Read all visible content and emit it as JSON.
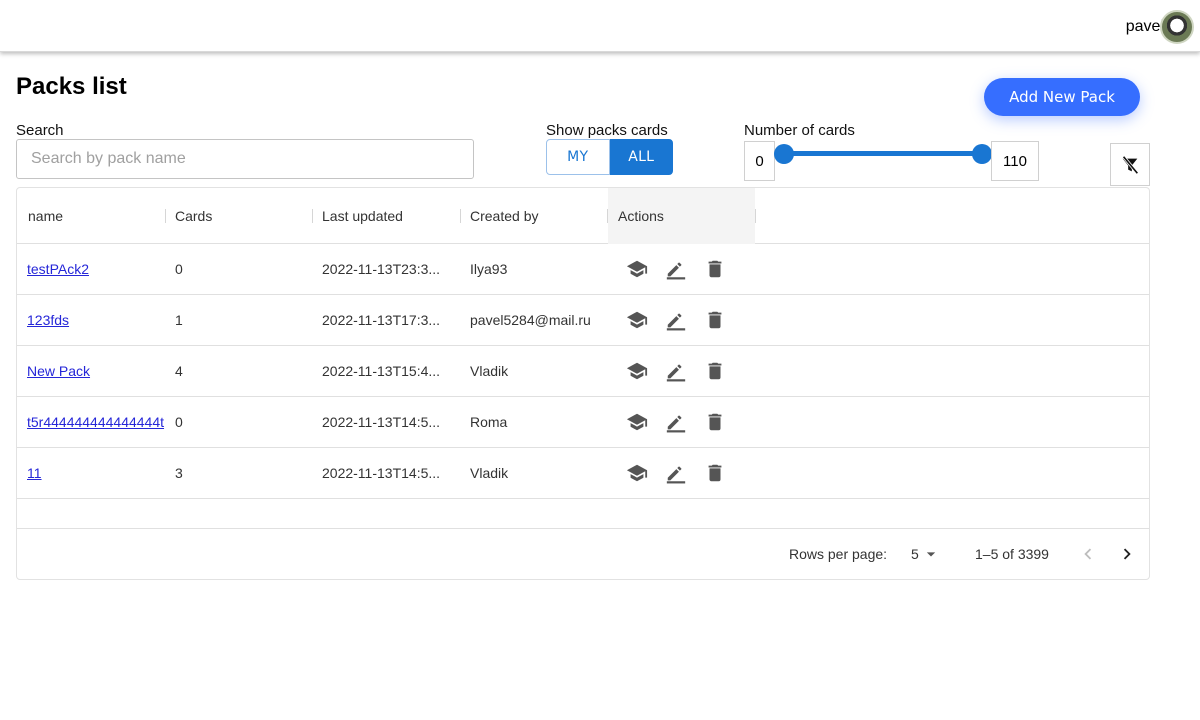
{
  "header": {
    "user_name": "pavel",
    "avatar_icon": "user-avatar"
  },
  "page": {
    "title": "Packs list",
    "add_button": "Add New Pack"
  },
  "search": {
    "label": "Search",
    "placeholder": "Search by pack name",
    "value": ""
  },
  "show_packs": {
    "label": "Show packs cards",
    "options": [
      "MY",
      "ALL"
    ],
    "selected": "ALL"
  },
  "number_of_cards": {
    "label": "Number of cards",
    "min": "0",
    "max": "110"
  },
  "filter": {
    "icon": "filter-off-icon"
  },
  "table": {
    "columns": [
      "name",
      "Cards",
      "Last updated",
      "Created by",
      "Actions"
    ],
    "rows": [
      {
        "name": "testPAck2",
        "cards": "0",
        "updated": "2022-11-13T23:3...",
        "created_by": "Ilya93"
      },
      {
        "name": "123fds",
        "cards": "1",
        "updated": "2022-11-13T17:3...",
        "created_by": "pavel5284@mail.ru"
      },
      {
        "name": "New Pack",
        "cards": "4",
        "updated": "2022-11-13T15:4...",
        "created_by": "Vladik"
      },
      {
        "name": "t5r444444444444444t",
        "cards": "0",
        "updated": "2022-11-13T14:5...",
        "created_by": "Roma"
      },
      {
        "name": "11",
        "cards": "3",
        "updated": "2022-11-13T14:5...",
        "created_by": "Vladik"
      }
    ]
  },
  "pagination": {
    "rows_per_page_label": "Rows per page:",
    "rows_per_page": "5",
    "range": "1–5 of 3399"
  },
  "colors": {
    "primary": "#1976d2",
    "add_button": "#366eff",
    "link": "#2526d8"
  }
}
